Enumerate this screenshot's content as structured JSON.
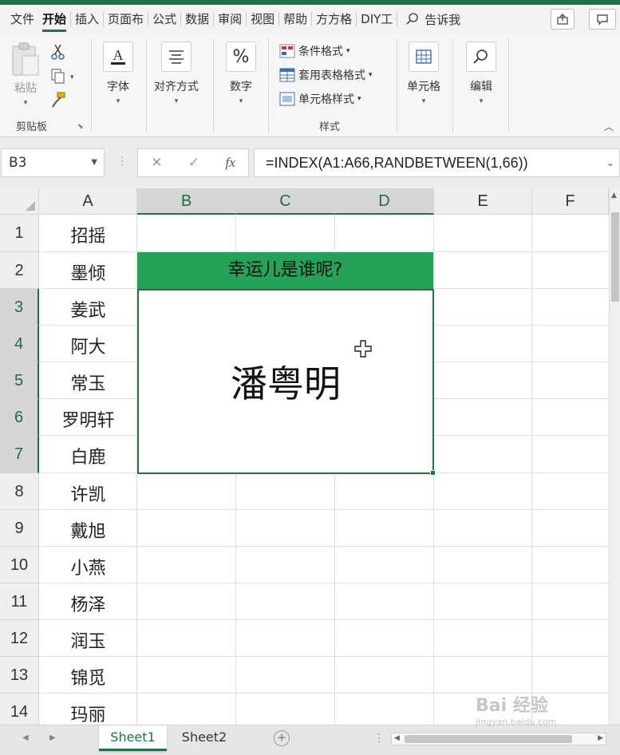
{
  "ribbon_tabs": [
    "文件",
    "开始",
    "插入",
    "页面布",
    "公式",
    "数据",
    "审阅",
    "视图",
    "帮助",
    "方方格",
    "DIY工"
  ],
  "active_tab": "开始",
  "tell_me": "告诉我",
  "clipboard": {
    "paste": "粘贴",
    "group": "剪贴板"
  },
  "font": {
    "label": "字体"
  },
  "alignment": {
    "label": "对齐方式"
  },
  "number": {
    "label": "数字"
  },
  "styles": {
    "conditional": "条件格式",
    "table": "套用表格格式",
    "cell": "单元格样式",
    "group": "样式"
  },
  "cells": {
    "label": "单元格"
  },
  "editing": {
    "label": "编辑"
  },
  "formula_bar": {
    "name_box": "B3",
    "formula": "=INDEX(A1:A66,RANDBETWEEN(1,66))"
  },
  "columns": [
    "A",
    "B",
    "C",
    "D",
    "E",
    "F"
  ],
  "rows": [
    "1",
    "2",
    "3",
    "4",
    "5",
    "6",
    "7",
    "8",
    "9",
    "10",
    "11",
    "12",
    "13",
    "14"
  ],
  "column_a_values": [
    "招摇",
    "墨倾",
    "姜武",
    "阿大",
    "常玉",
    "罗明轩",
    "白鹿",
    "许凯",
    "戴旭",
    "小燕",
    "杨泽",
    "润玉",
    "锦觅",
    "玛丽"
  ],
  "banner_text": "幸运儿是谁呢?",
  "result_name": "潘粤明",
  "sheets": [
    "Sheet1",
    "Sheet2"
  ],
  "active_sheet": "Sheet1",
  "watermark": {
    "brand": "Bai 经验",
    "url": "jingyan.baidu.com"
  },
  "colors": {
    "accent": "#1f7145",
    "banner": "#23a258"
  }
}
